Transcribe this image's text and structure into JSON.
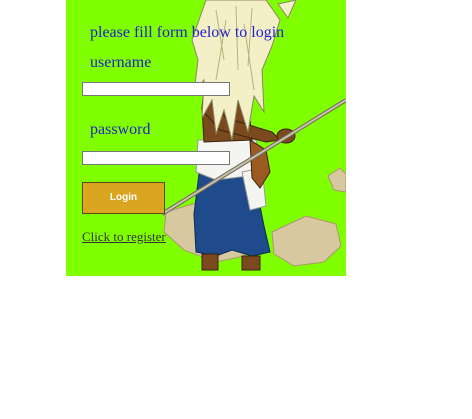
{
  "form": {
    "intro_text": "please fill form below to login",
    "username_label": "username",
    "username_value": "",
    "password_label": "password",
    "password_value": "",
    "login_label": "Login",
    "register_link_text": "Click to register"
  },
  "background": {
    "color": "#80ff00",
    "illustration": "spear-warrior-character"
  },
  "colors": {
    "heading_text": "#2222cc",
    "button": "#daa520",
    "link": "#333333"
  }
}
